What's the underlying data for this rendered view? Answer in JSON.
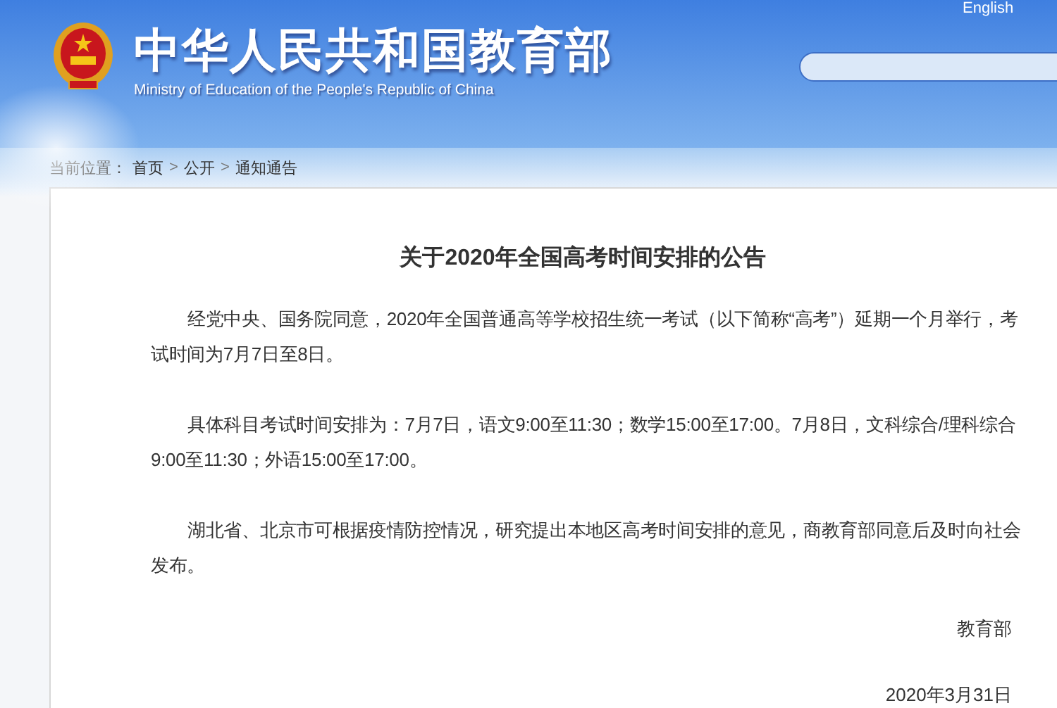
{
  "header": {
    "title": "中华人民共和国教育部",
    "subtitle": "Ministry of Education of the People's Republic of China",
    "language_link": "English"
  },
  "breadcrumb": {
    "label": "当前位置：",
    "separator": ">",
    "items": [
      "首页",
      "公开",
      "通知通告"
    ]
  },
  "article": {
    "title": "关于2020年全国高考时间安排的公告",
    "paragraphs": [
      "经党中央、国务院同意，2020年全国普通高等学校招生统一考试（以下简称“高考”）延期一个月举行，考试时间为7月7日至8日。",
      "具体科目考试时间安排为：7月7日，语文9:00至11:30；数学15:00至17:00。7月8日，文科综合/理科综合9:00至11:30；外语15:00至17:00。",
      "湖北省、北京市可根据疫情防控情况，研究提出本地区高考时间安排的意见，商教育部同意后及时向社会发布。"
    ],
    "signature": "教育部",
    "date": "2020年3月31日"
  }
}
